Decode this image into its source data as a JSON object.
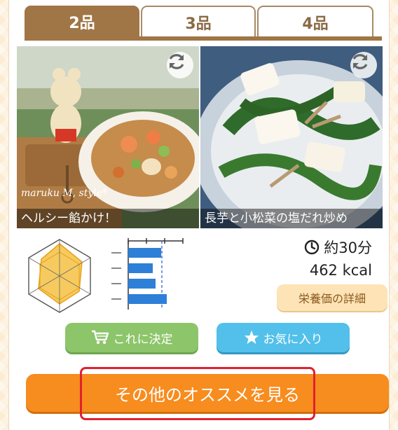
{
  "tabs": [
    {
      "label": "2品",
      "active": true
    },
    {
      "label": "3品",
      "active": false
    },
    {
      "label": "4品",
      "active": false
    }
  ],
  "photos": [
    {
      "caption": "ヘルシー餡かけ！",
      "watermark": "maruku M, style*",
      "icon": "refresh-icon"
    },
    {
      "caption": "長芋と小松菜の塩だれ炒め",
      "icon": "refresh-icon"
    }
  ],
  "nutrition": {
    "radar_icon": "radar-chart",
    "bar_chart": {
      "values": [
        0.6,
        0.45,
        0.5,
        0.7
      ]
    }
  },
  "info": {
    "time": "約30分",
    "time_icon": "clock-icon",
    "kcal": "462 kcal",
    "nutrition_detail_label": "栄養価の詳細"
  },
  "actions": {
    "decide_label": "これに決定",
    "decide_icon": "cart-icon",
    "favorite_label": "お気に入り",
    "favorite_icon": "star-icon",
    "more_label": "その他のオススメを見る"
  },
  "colors": {
    "tab_active": "#a07646",
    "decide": "#8dc56a",
    "favorite": "#52c0ea",
    "more": "#f78c1f",
    "highlight": "#e0222c"
  }
}
